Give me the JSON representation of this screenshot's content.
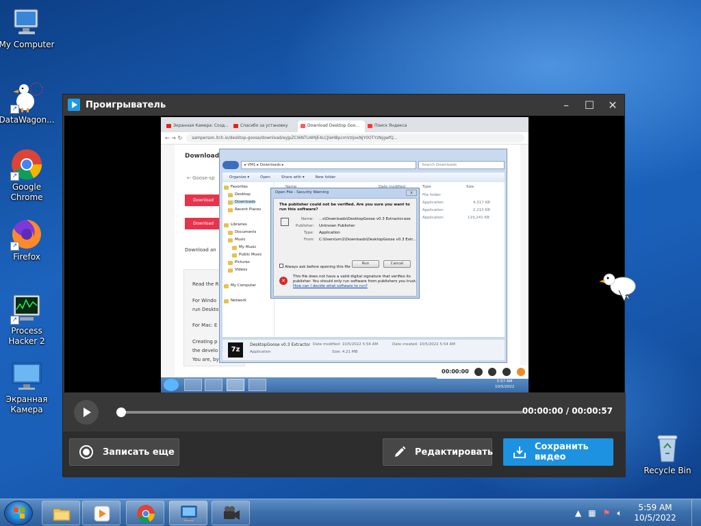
{
  "desktop": {
    "icons": [
      {
        "label": "My Computer",
        "icon": "computer-icon"
      },
      {
        "label": "DataWagon...",
        "icon": "goose-icon"
      },
      {
        "label": "Google Chrome",
        "icon": "chrome-icon"
      },
      {
        "label": "Firefox",
        "icon": "firefox-icon"
      },
      {
        "label": "Process Hacker 2",
        "icon": "process-hacker-icon"
      },
      {
        "label": "Экранная Камера",
        "icon": "screen-camera-icon"
      },
      {
        "label": "Recycle Bin",
        "icon": "recycle-bin-icon"
      }
    ]
  },
  "player": {
    "title": "Проигрыватель",
    "time": "00:00:00 / 00:00:57",
    "progress": 0,
    "buttons": {
      "record_again": "Записать еще",
      "edit": "Редактировать",
      "save": "Сохранить видео"
    },
    "accent": "#1d92e0"
  },
  "capture": {
    "tabs": [
      "Экранная Камера: Созд...",
      "Спасибо за установку",
      "Download Desktop Goo...",
      "Поиск Яндекса"
    ],
    "url": "samperson.itch.io/desktop-goose/download/eyJpZCI6NTU4MjE4LCJleHBpcmVzIjoxNjY0OTYzNjgwfQ...",
    "page": {
      "heading": "Download",
      "back_link": "← Goose-sp",
      "download_label": "Download",
      "download_and": "Download an",
      "read": "Read the R",
      "windows": "For Windo",
      "run": "run Deskto",
      "mac": "For Mac: E",
      "creating": "Creating p",
      "developer": "the develo",
      "you_are": "You are, by"
    },
    "explorer": {
      "path": "▸ VM1 ▸ Downloads ▸",
      "search_placeholder": "Search Downloads",
      "toolbar": [
        "Organize ▾",
        "Open",
        "Share with ▾",
        "New folder"
      ],
      "tree": [
        "Favorites",
        "Desktop",
        "Downloads",
        "Recent Places",
        "Libraries",
        "Documents",
        "Music",
        "My Music",
        "Public Music",
        "Pictures",
        "Videos",
        "My Computer",
        "Network"
      ],
      "columns": [
        "Name",
        "Date modified",
        "Type",
        "Size"
      ],
      "rows": [
        {
          "type": "File folder",
          "size": ""
        },
        {
          "type": "Application",
          "size": "4,317 KB"
        },
        {
          "type": "Application",
          "size": "2,215 KB"
        },
        {
          "type": "Application",
          "size": "119,241 KB"
        }
      ],
      "status": {
        "name": "DesktopGoose v0.3 Extractor",
        "date_modified": "Date modified: 10/5/2022 5:54 AM",
        "date_created": "Date created: 10/5/2022 5:54 AM",
        "type": "Application",
        "size": "Size: 4.21 MB"
      }
    },
    "security": {
      "title": "Open File - Security Warning",
      "question_line1": "The publisher could not be verified.  Are you sure you want to",
      "question_line2": "run this software?",
      "name_label": "Name:",
      "name_value": "...s\\Downloads\\DesktopGoose v0.3 Extractor.exe",
      "publisher_label": "Publisher:",
      "publisher_value": "Unknown Publisher",
      "type_label": "Type:",
      "type_value": "Application",
      "from_label": "From:",
      "from_value": "C:\\Users\\vm1\\Downloads\\DesktopGoose v0.3 Extr...",
      "run": "Run",
      "cancel": "Cancel",
      "always_ask": "Always ask before opening this file",
      "warn_line1": "This file does not have a valid digital signature that verifies its",
      "warn_line2": "publisher.  You should only run software from publishers you trust.",
      "warn_link": "How can I decide what software to run?"
    },
    "recorder_time": "00:00:00",
    "clock": {
      "time": "5:57 AM",
      "date": "10/5/2022"
    }
  },
  "taskbar": {
    "apps": [
      "explorer-icon",
      "media-player-icon",
      "chrome-icon",
      "remote-desktop-icon",
      "camera-icon"
    ],
    "time": "5:59 AM",
    "date": "10/5/2022"
  }
}
